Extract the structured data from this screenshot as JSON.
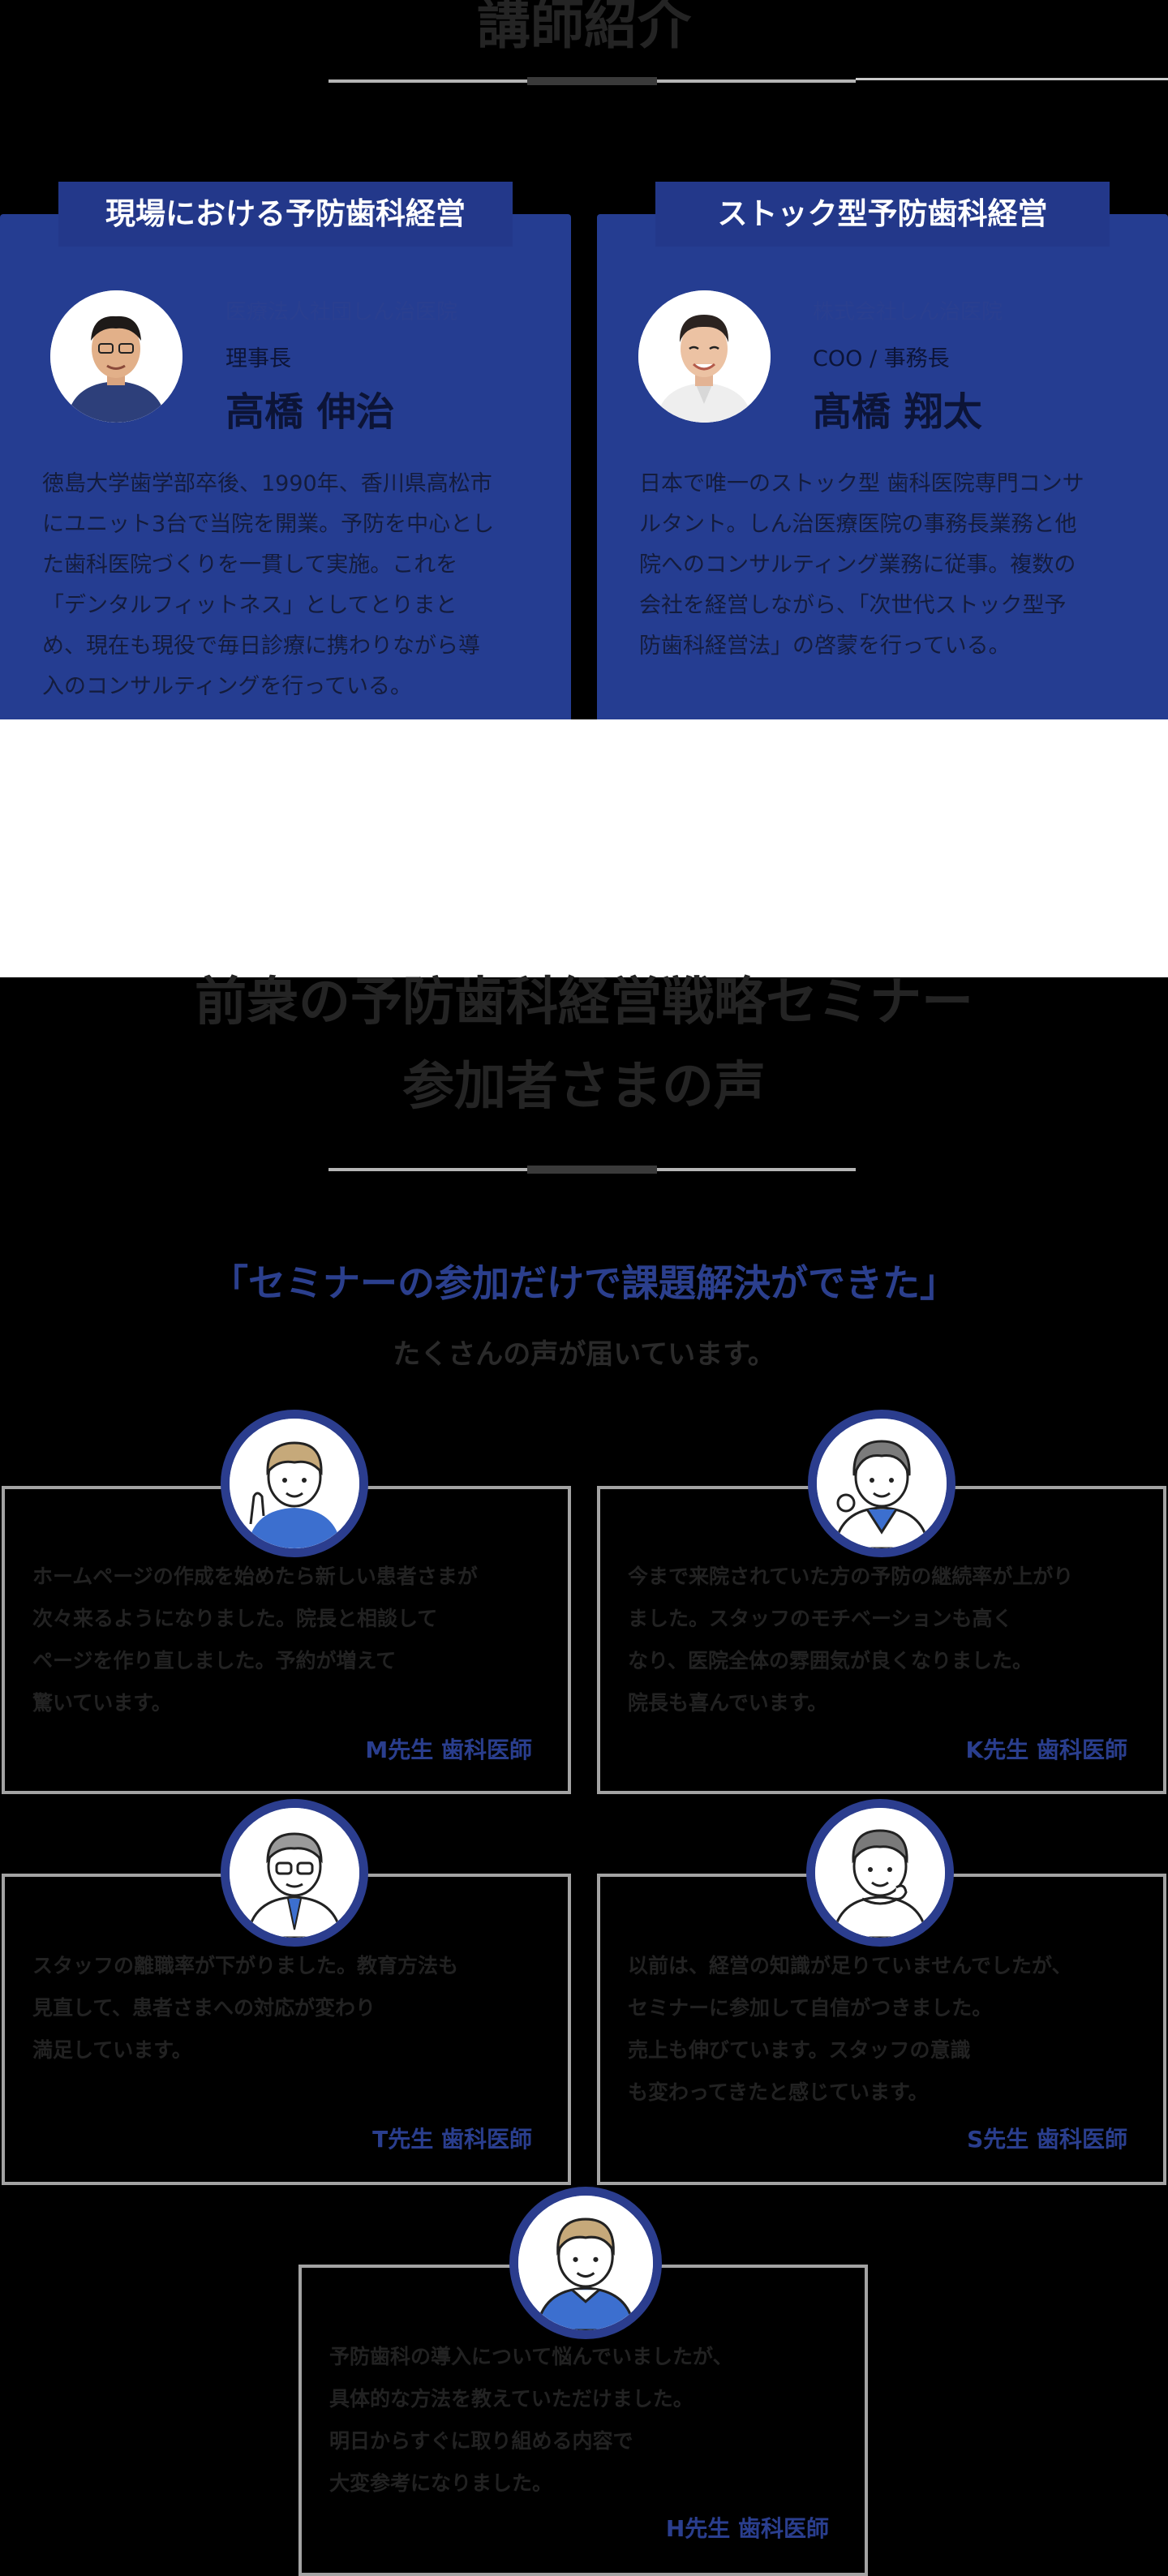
{
  "colors": {
    "brand_navy": "#253d91",
    "tab_navy": "#23388a",
    "divider_gray": "#b5b5b5",
    "divider_dark": "#3a3a3a",
    "border_gray": "#a3a3a3",
    "background": "#000000"
  },
  "section_lecturers": {
    "title": "講師紹介",
    "cards": [
      {
        "tab": "現場における予防歯科経営",
        "org": "医療法人社団しん治医院",
        "role": "理事長",
        "name": "高橋 伸治",
        "bio": [
          "徳島大学歯学部卒後、1990年、香川県高松市",
          "にユニット3台で当院を開業。予防を中心とし",
          "た歯科医院づくりを一貫して実施。これを",
          "「デンタルフィットネス」としてとりまと",
          "め、現在も現役で毎日診療に携わりながら導",
          "入のコンサルティングを行っている。"
        ]
      },
      {
        "tab": "ストック型予防歯科経営",
        "org": "株式会社しん治医院",
        "role": "COO / 事務長",
        "name": "髙橋 翔太",
        "bio": [
          "日本で唯一のストック型 歯科医院専門コンサ",
          "ルタント。しん治医療医院の事務長業務と他",
          "院へのコンサルティング業務に従事。複数の",
          "会社を経営しながら、「次世代ストック型予",
          "防歯科経営法」の啓蒙を行っている。"
        ]
      }
    ]
  },
  "section_voices": {
    "title_line1": "前衆の予防歯科経営戦略セミナー",
    "title_line2": "参加者さまの声",
    "lead_blue": "「セミナーの参加だけで課題解決ができた」",
    "lead_gray": "たくさんの声が届いています。",
    "testimonials": [
      {
        "text": [
          "ホームページの作成を始めたら新しい患者さまが",
          "次々来るようになりました。院長と相談して",
          "ページを作り直しました。予約が増えて",
          "驚いています。"
        ],
        "name": "M先生 歯科医師"
      },
      {
        "text": [
          "今まで来院されていた方の予防の継続率が上がり",
          "ました。スタッフのモチベーションも高く",
          "なり、医院全体の雰囲気が良くなりました。",
          "院長も喜んでいます。"
        ],
        "name": "K先生 歯科医師"
      },
      {
        "text": [
          "スタッフの離職率が下がりました。教育方法も",
          "見直して、患者さまへの対応が変わり",
          "満足しています。"
        ],
        "name": "T先生 歯科医師"
      },
      {
        "text": [
          "以前は、経営の知識が足りていませんでしたが、",
          "セミナーに参加して自信がつきました。",
          "売上も伸びています。スタッフの意識",
          "も変わってきたと感じています。"
        ],
        "name": "S先生 歯科医師"
      },
      {
        "text": [
          "予防歯科の導入について悩んでいましたが、",
          "具体的な方法を教えていただけました。",
          "明日からすぐに取り組める内容で",
          "大変参考になりました。"
        ],
        "name": "H先生 歯科医師"
      }
    ]
  }
}
